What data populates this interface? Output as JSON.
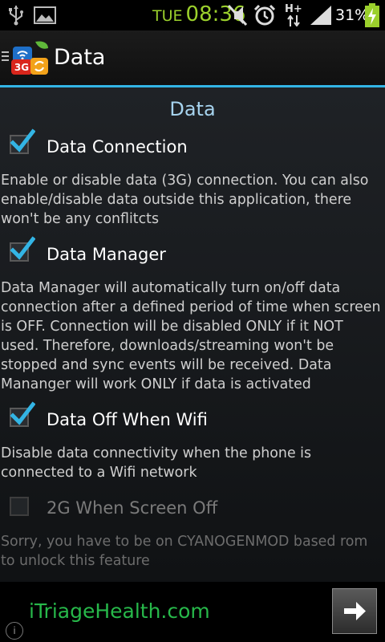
{
  "status_bar": {
    "day": "TUE",
    "time": "08:36",
    "network": "H+",
    "battery_percent": "31%",
    "icons": [
      "usb-icon",
      "image-icon",
      "silent-mode-icon",
      "alarm-icon",
      "data-arrows-icon",
      "signal-icon",
      "battery-charging-icon"
    ]
  },
  "action_bar": {
    "title": "Data",
    "app_icon": "app-logo-3g-icon",
    "menu_icon": "drawer-menu-icon"
  },
  "section": {
    "title": "Data"
  },
  "preferences": [
    {
      "title": "Data Connection",
      "checked": true,
      "enabled": true,
      "summary": "Enable or disable data (3G) connection. You can also enable/disable data outside this application, there won't be any conflitcts"
    },
    {
      "title": "Data Manager",
      "checked": true,
      "enabled": true,
      "summary": "Data Manager will automatically turn on/off data connection after a defined period of time when screen is OFF. Connection will be disabled ONLY if it NOT used. Therefore, downloads/streaming won't be stopped and sync events will be received. Data Mananger will work ONLY if data is activated"
    },
    {
      "title": "Data Off When Wifi",
      "checked": true,
      "enabled": true,
      "summary": "Disable data connectivity when the phone is connected to a Wifi network"
    },
    {
      "title": "2G When Screen Off",
      "checked": false,
      "enabled": false,
      "summary": "Sorry, you have to be on CYANOGENMOD based rom to unlock this feature"
    }
  ],
  "ad": {
    "text": "iTriageHealth.com",
    "info_label": "i",
    "arrow_icon": "arrow-right-icon"
  },
  "colors": {
    "accent": "#33b5e5",
    "section_title": "#a6d3ee",
    "clock": "#9bd02c",
    "ad_text": "#27b84a",
    "check": "#33b5e5"
  }
}
